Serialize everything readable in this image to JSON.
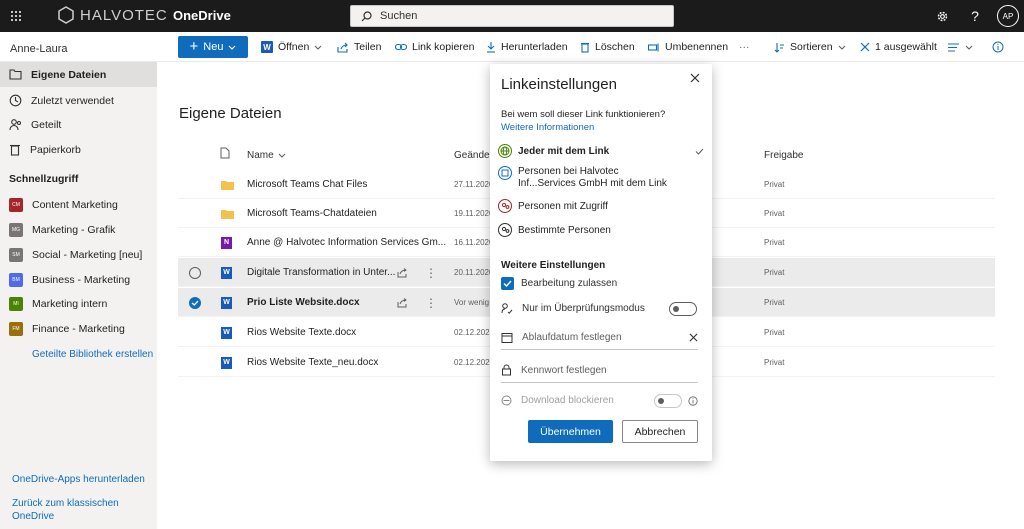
{
  "topbar": {
    "brand": "HALVOTEC",
    "app_name": "OneDrive",
    "search_placeholder": "Suchen",
    "avatar_initials": "AP",
    "icons": [
      "waffle-icon",
      "search-icon",
      "gear-icon",
      "help-icon"
    ]
  },
  "commandbar": {
    "new_label": "Neu",
    "open_label": "Öffnen",
    "share_label": "Teilen",
    "copy_link_label": "Link kopieren",
    "download_label": "Herunterladen",
    "delete_label": "Löschen",
    "rename_label": "Umbenennen",
    "more_label": "···",
    "sort_label": "Sortieren",
    "selected_label": "1 ausgewählt"
  },
  "sidebar": {
    "user": "Anne-Laura",
    "nav": [
      {
        "label": "Eigene Dateien",
        "active": true
      },
      {
        "label": "Zuletzt verwendet"
      },
      {
        "label": "Geteilt"
      },
      {
        "label": "Papierkorb"
      }
    ],
    "quick_access_title": "Schnellzugriff",
    "quick_access": [
      {
        "label": "Content Marketing",
        "color": "#a4262c",
        "abbr": "CM"
      },
      {
        "label": "Marketing - Grafik",
        "color": "#7a7574",
        "abbr": "MG"
      },
      {
        "label": "Social - Marketing [neu]",
        "color": "#7a7574",
        "abbr": "SM"
      },
      {
        "label": "Business - Marketing",
        "color": "#4f6bed",
        "abbr": "BM"
      },
      {
        "label": "Marketing intern",
        "color": "#498205",
        "abbr": "MI"
      },
      {
        "label": "Finance - Marketing",
        "color": "#986f0b",
        "abbr": "FM"
      }
    ],
    "create_library": "Geteilte Bibliothek erstellen",
    "download_apps": "OneDrive-Apps herunterladen",
    "classic": "Zurück zum klassischen OneDrive"
  },
  "main": {
    "title": "Eigene Dateien",
    "columns": {
      "name": "Name",
      "modified": "Geänder",
      "sharing": "Freigabe"
    },
    "files": [
      {
        "name": "Microsoft Teams Chat Files",
        "date": "27.11.2020",
        "sharing": "Privat",
        "type": "folder"
      },
      {
        "name": "Microsoft Teams-Chatdateien",
        "date": "19.11.2020",
        "sharing": "Privat",
        "type": "folder"
      },
      {
        "name": "Anne @ Halvotec Information Services Gm...",
        "date": "16.11.2020",
        "sharing": "Privat",
        "type": "onenote"
      },
      {
        "name": "Digitale Transformation in Unter...",
        "date": "20.11.2020",
        "sharing": "Privat",
        "type": "word",
        "hover": true
      },
      {
        "name": "Prio Liste Website.docx",
        "date": "Vor wenig",
        "sharing": "Privat",
        "type": "word",
        "selected": true
      },
      {
        "name": "Rios Website Texte.docx",
        "date": "02.12.2020",
        "sharing": "Privat",
        "type": "word"
      },
      {
        "name": "Rios Website Texte_neu.docx",
        "date": "02.12.2020",
        "sharing": "Privat",
        "type": "word"
      }
    ]
  },
  "dialog": {
    "title": "Linkeinstellungen",
    "question": "Bei wem soll dieser Link funktionieren?",
    "more_info": "Weitere Informationen",
    "options": [
      {
        "label": "Jeder mit dem Link",
        "selected": true
      },
      {
        "label": "Personen bei Halvotec Inf...Services GmbH mit dem Link"
      },
      {
        "label": "Personen mit Zugriff"
      },
      {
        "label": "Bestimmte Personen"
      }
    ],
    "more_settings": "Weitere Einstellungen",
    "allow_edit": "Bearbeitung zulassen",
    "review_mode": "Nur im Überprüfungsmodus",
    "expiry": "Ablaufdatum festlegen",
    "password": "Kennwort festlegen",
    "block_download": "Download blockieren",
    "apply": "Übernehmen",
    "cancel": "Abbrechen",
    "accent": "#0f6cbd"
  }
}
